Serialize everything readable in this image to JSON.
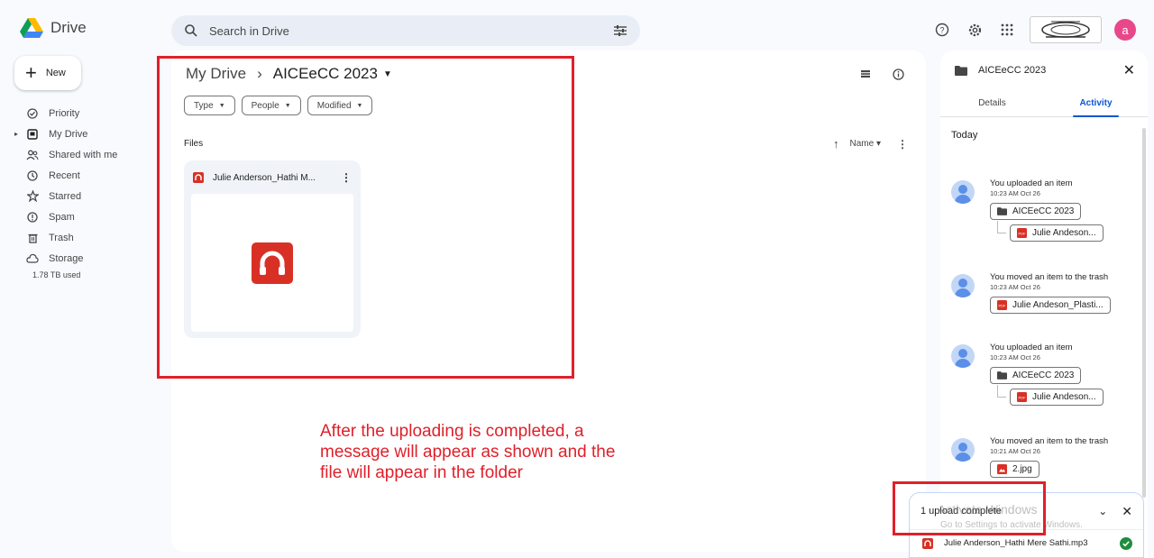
{
  "app": {
    "name": "Drive"
  },
  "search": {
    "placeholder": "Search in Drive"
  },
  "header": {
    "avatar_letter": "a"
  },
  "sidebar": {
    "new_label": "New",
    "items": [
      {
        "label": "Priority",
        "icon": "checkbox-icon"
      },
      {
        "label": "My Drive",
        "icon": "drive-icon"
      },
      {
        "label": "Shared with me",
        "icon": "people-icon"
      },
      {
        "label": "Recent",
        "icon": "clock-icon"
      },
      {
        "label": "Starred",
        "icon": "star-icon"
      },
      {
        "label": "Spam",
        "icon": "spam-icon"
      },
      {
        "label": "Trash",
        "icon": "trash-icon"
      },
      {
        "label": "Storage",
        "icon": "cloud-icon"
      }
    ],
    "storage_used": "1.78 TB used"
  },
  "main": {
    "breadcrumb_root": "My Drive",
    "breadcrumb_separator": "›",
    "breadcrumb_current": "AICEeCC 2023",
    "filters": [
      "Type",
      "People",
      "Modified"
    ],
    "files_label": "Files",
    "sort_label": "Name",
    "file": {
      "name": "Julie Anderson_Hathi M..."
    }
  },
  "annotation": {
    "text": "After the uploading is completed, a message will appear as shown and the file will appear in the folder"
  },
  "panel": {
    "folder_name": "AICEeCC 2023",
    "tabs": [
      "Details",
      "Activity"
    ],
    "active_tab": "Activity",
    "today_label": "Today",
    "activities": [
      {
        "title": "You uploaded an item",
        "time": "10:23 AM Oct 26",
        "folder": "AICEeCC 2023",
        "file": "Julie Andeson..."
      },
      {
        "title": "You moved an item to the trash",
        "time": "10:23 AM Oct 26",
        "file": "Julie Andeson_Plasti..."
      },
      {
        "title": "You uploaded an item",
        "time": "10:23 AM Oct 26",
        "folder": "AICEeCC 2023",
        "file": "Julie Andeson..."
      },
      {
        "title": "You moved an item to the trash",
        "time": "10:21 AM Oct 26",
        "file": "2.jpg"
      }
    ]
  },
  "toast": {
    "title": "1 upload complete",
    "file_name": "Julie Anderson_Hathi Mere Sathi.mp3"
  },
  "watermark": {
    "line1": "Activate Windows",
    "line2": "Go to Settings to activate Windows."
  },
  "colors": {
    "accent": "#0b57d0",
    "annotation": "#e0202a",
    "audio_file": "#d93025",
    "success": "#1e8e3e"
  }
}
